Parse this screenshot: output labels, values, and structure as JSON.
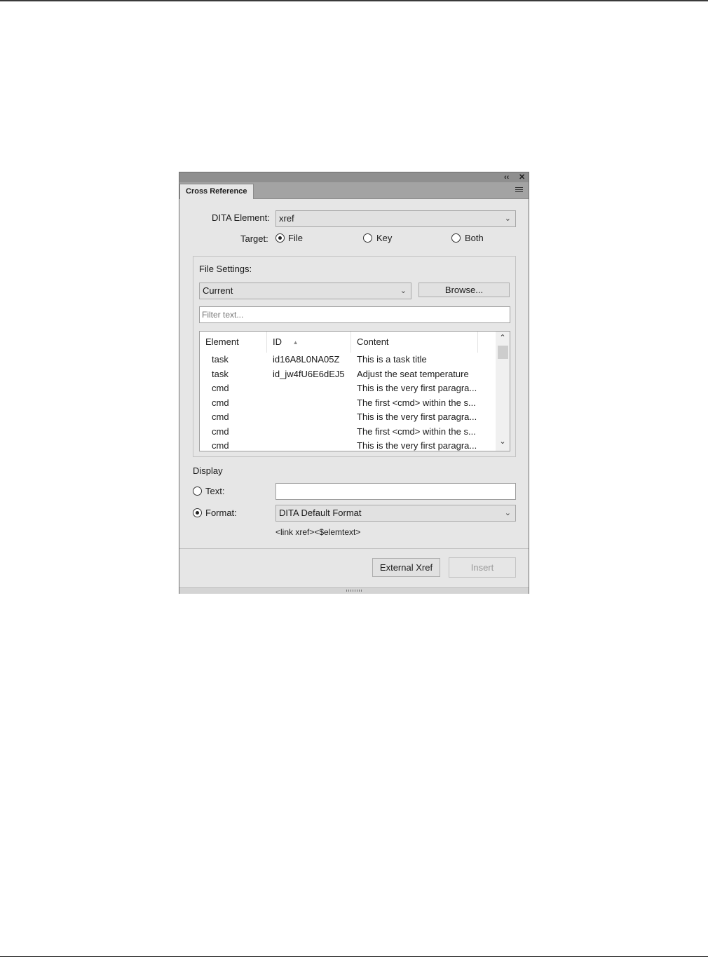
{
  "panel": {
    "title": "Cross Reference",
    "collapse_icon": "double-chevron-left-icon",
    "close_icon": "close-icon",
    "collapse_glyph": "‹‹",
    "close_glyph": "✕"
  },
  "form": {
    "dita_element_label": "DITA Element:",
    "dita_element_value": "xref",
    "target_label": "Target:",
    "target_options": [
      "File",
      "Key",
      "Both"
    ],
    "target_selected": "File"
  },
  "file_settings": {
    "label": "File Settings:",
    "file_value": "Current",
    "browse_label": "Browse...",
    "filter_placeholder": "Filter text...",
    "columns": [
      "Element",
      "ID",
      "Content"
    ],
    "sort_icon": "sort-ascending-icon",
    "sort_glyph": "▲",
    "rows": [
      {
        "element": "task",
        "id": "id16A8L0NA05Z",
        "content": "This is a task title"
      },
      {
        "element": "task",
        "id": "id_jw4fU6E6dEJ5",
        "content": "Adjust the seat temperature"
      },
      {
        "element": "cmd",
        "id": "",
        "content": "This is the very first paragra..."
      },
      {
        "element": "cmd",
        "id": "",
        "content": "The first <cmd> within the s..."
      },
      {
        "element": "cmd",
        "id": "",
        "content": "This is the very first paragra..."
      },
      {
        "element": "cmd",
        "id": "",
        "content": "The first <cmd> within the s..."
      },
      {
        "element": "cmd",
        "id": "",
        "content": "This is the very first paragra..."
      }
    ]
  },
  "display": {
    "label": "Display",
    "text_label": "Text:",
    "text_value": "",
    "format_label": "Format:",
    "format_value": "DITA Default Format",
    "selected": "Format",
    "format_preview": "<link xref><$elemtext>"
  },
  "buttons": {
    "external_xref": "External Xref",
    "insert": "Insert",
    "insert_enabled": false
  }
}
